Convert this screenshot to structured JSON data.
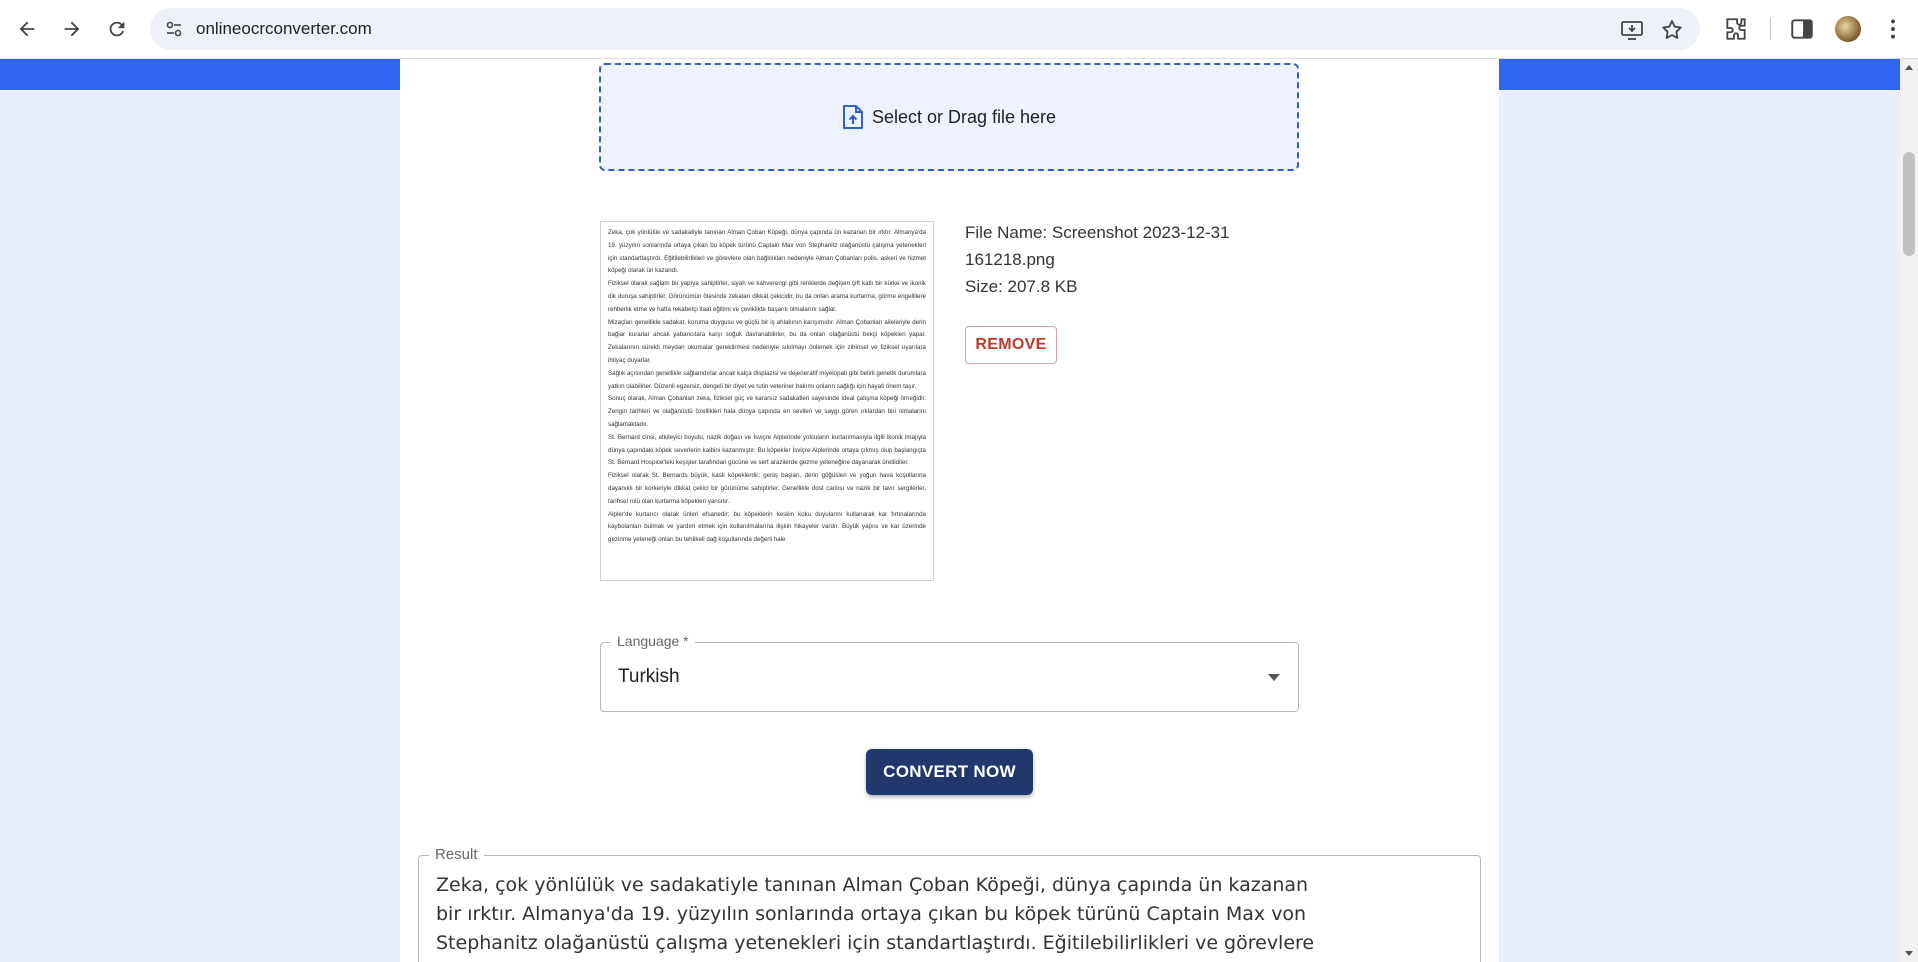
{
  "browser": {
    "url": "onlineocrconverter.com",
    "icons": [
      "back-arrow-icon",
      "forward-arrow-icon",
      "reload-icon",
      "site-settings-icon",
      "install-app-icon",
      "bookmark-star-icon",
      "extensions-puzzle-icon",
      "side-panel-icon",
      "profile-avatar",
      "menu-kebab-icon"
    ]
  },
  "colors": {
    "brand_blue": "#2f67f2",
    "page_bg": "#eaf0fb",
    "dropzone_border": "#2f5fc7",
    "convert_button": "#21386d",
    "remove_text": "#c0392b"
  },
  "upload": {
    "dropzone_label": "Select or Drag file here",
    "icon": "file-upload-icon"
  },
  "file": {
    "name_line": "File Name: Screenshot 2023-12-31 161218.png",
    "size_line": "Size: 207.8 KB",
    "remove_label": "REMOVE",
    "preview_paragraphs": [
      "Zeka, çok yönlülük ve sadakatiyle tanınan Alman Çoban Köpeği, dünya çapında ün kazanan bir ırktır. Almanya'da 19. yüzyılın sonlarında ortaya çıkan bu köpek türünü Captain Max von Stephanitz olağanüstü çalışma yetenekleri için standartlaştırdı. Eğitilebilirlikleri ve görevlere olan bağlılıkları nedeniyle Alman Çobanları polis, askeri ve hizmet köpeği olarak ün kazandı.",
      "Fiziksel olarak sağlam bir yapıya sahiptirler, siyah ve kahverengi gibi renklerde değişen çift katlı bir kürke ve ikonik dik duruşa sahiptirler. Görünümün ötesinde zekaları dikkat çekicidir, bu da onları arama kurtarma, görme engellilere rehberlik etme ve hatta rekabetçi itaat eğitimi ve çeviklikte başarılı olmalarını sağlar.",
      "Mizaçları genellikle sadakat, koruma duygusu ve güçlü bir iş ahlakının karışımıdır. Alman Çobanları aileleriyle derin bağlar kurarlar ancak yabancılara karşı soğuk davranabilirler, bu da onları olağanüstü bekçi köpekleri yapar. Zekalarının sürekli meydan okumalar gerektirmesi nedeniyle sıkılmayı önlemek için zihinsel ve fiziksel uyarılara ihtiyaç duyarlar.",
      "Sağlık açısından genellikle sağlamdırlar ancak kalça displazisi ve dejeneratif miyelopati gibi belirli genetik durumlara yatkın olabilirler. Düzenli egzersiz, dengeli bir diyet ve rutin veteriner bakımı onların sağlığı için hayati önem taşır.",
      "Sonuç olarak, Alman Çobanları zeka, fiziksel güç ve kararsız sadakatleri sayesinde ideal çalışma köpeği örneğidir. Zengin tarihleri ve olağanüstü özellikleri hala dünya çapında en sevilen ve saygı gören ırklardan biri olmalarını sağlamaktadır.",
      "St. Bernard cinsi, etkileyici boyutu, nazik doğası ve İsviçre Alplerinde yolcuların kurtarılmasıyla ilgili ikonik imajıyla dünya çapındaki köpek severlerin kalbini kazanmıştır. Bu köpekler İsviçre Alplerinde ortaya çıkmış olup başlangıçta St. Bernard Hospice'teki keşişler tarafından gücüne ve sert arazilerde gezme yeteneğine dayanarak üretildiler.",
      "Fiziksel olarak St. Bernards büyük, kaslı köpeklerdir; geniş başları, derin göğüsleri ve yoğun hava koşullarına dayanıklı bir korkeriyle dikkat çekici bir görünüme sahiptirler. Genellikle dost canlısı ve nazik bir tavır sergilerler, tarihsel rolü olan kurtarma köpekleri yansıtır.",
      "Alpler'de kurtarıcı olarak ünleri efsanedir; bu köpeklerin keskin koku duyularını kullanarak kar fırtınalarında kaybolanları bulmak ve yardım etmek için kullanılmalarına ilişkin hikayeler vardır. Büyük yapısı ve kar üzerinde gezinme yeteneği onları bu tehlikeli dağ koşullarında değerli hale"
    ]
  },
  "language": {
    "label": "Language *",
    "value": "Turkish"
  },
  "convert": {
    "label": "CONVERT NOW"
  },
  "result": {
    "label": "Result",
    "text": "Zeka, çok yönlülük ve sadakatiyle tanınan Alman Çoban Köpeği, dünya çapında ün kazanan bir ırktır. Almanya'da 19. yüzyılın sonlarında ortaya çıkan bu köpek türünü Captain Max von Stephanitz olağanüstü çalışma yetenekleri için standartlaştırdı. Eğitilebilirlikleri ve görevlere olan"
  }
}
